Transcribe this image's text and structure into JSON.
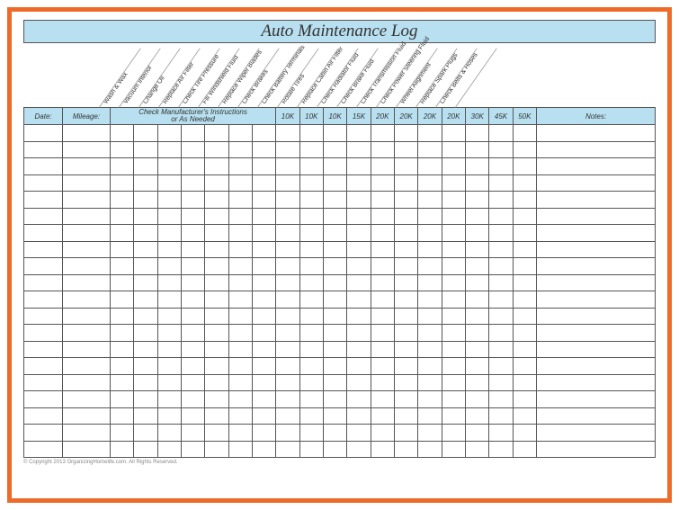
{
  "title": "Auto Maintenance Log",
  "columns": {
    "date": "Date:",
    "mileage": "Mileage:",
    "instructions_line1": "Check Manufacturer's Instructions",
    "instructions_line2": "or As Needed",
    "notes": "Notes:"
  },
  "tasks": [
    "Wash & Wax",
    "Vacuum Interior",
    "Change Oil",
    "Replace Air Filter",
    "Check Tire Pressure",
    "Fill Windshield Fluid",
    "Replace Wiper Blades",
    "Check Brakes",
    "Check Battery Terminals",
    "Rotate Tires",
    "Replace Cabin Air Filter",
    "Check Radiator Fluid",
    "Check Brake Fluid",
    "Check Transmission Fluid",
    "Check Power Steering Fluid",
    "Wheel Alignment",
    "Replace Spark Plugs",
    "Check Belts & Hoses"
  ],
  "intervals": [
    "10K",
    "10K",
    "10K",
    "15K",
    "20K",
    "20K",
    "20K",
    "20K",
    "30K",
    "45K",
    "50K"
  ],
  "row_count": 20,
  "footer": "© Copyright 2013 OrganizingHomelife.com. All Rights Reserved."
}
